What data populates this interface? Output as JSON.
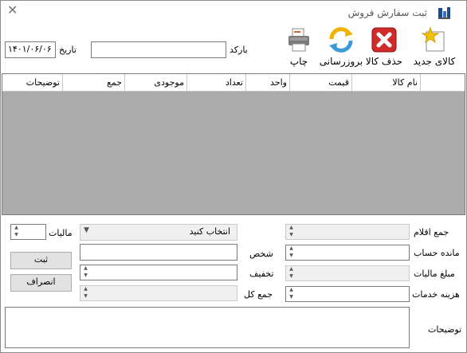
{
  "window": {
    "title": "ثبت سفارش فروش"
  },
  "toolbar": {
    "new_item": "کالای جدید",
    "delete_item": "حذف کالا",
    "refresh": "بروزرسانی",
    "print": "چاپ"
  },
  "header": {
    "barcode_label": "بارکد",
    "barcode_value": "",
    "date_label": "تاریخ",
    "date_value": "۱۴۰۱/۰۶/۰۶"
  },
  "grid": {
    "columns": [
      "نام کالا",
      "قیمت",
      "واحد",
      "تعداد",
      "موجودی",
      "جمع",
      "توضیحات"
    ]
  },
  "form": {
    "items_total_label": "جمع اقلام",
    "items_total_value": "",
    "account_balance_label": "مانده حساب",
    "account_balance_value": "",
    "tax_amount_label": "مبلغ مالیات",
    "tax_amount_value": "",
    "service_cost_label": "هزینه خدمات",
    "service_cost_value": "",
    "person_dropdown_value": "انتخاب کنید",
    "person_label": "شخص",
    "person_value": "",
    "discount_label": "تخفیف",
    "discount_value": "",
    "grand_total_label": "جمع کل",
    "grand_total_value": "",
    "tax_label": "مالیات",
    "tax_value": "",
    "notes_label": "توضیحات",
    "notes_value": "",
    "save_button": "ثبت",
    "cancel_button": "انصراف"
  }
}
